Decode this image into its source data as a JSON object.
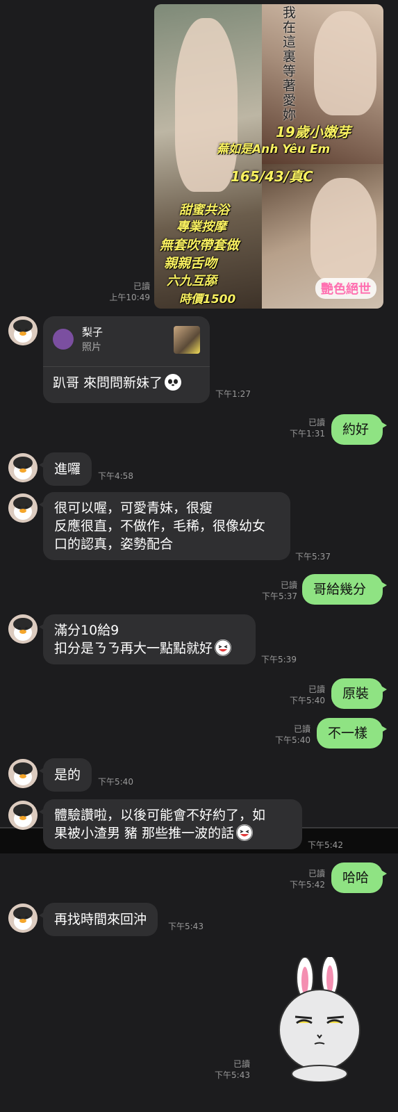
{
  "poster": {
    "vertical_text": "我在這裏等著愛妳",
    "age_label": "19歲小嫩芽",
    "name_line": "蕪如是Anh Yêu Em",
    "stats": "165/43/真C",
    "services": [
      "甜蜜共浴",
      "專業按摩",
      "無套吹帶套做",
      "親親舌吻",
      "六九互舔",
      "時價1500"
    ],
    "brand": "艷色絕世",
    "read": "已讀",
    "time": "上午10:49"
  },
  "quote_card": {
    "name": "梨子",
    "sub": "照片",
    "text": "趴哥  來問問新妹了",
    "time": "下午1:27"
  },
  "messages": [
    {
      "side": "out",
      "text": "約好",
      "read": "已讀",
      "time": "下午1:31"
    },
    {
      "side": "in",
      "text": "進囉",
      "time": "下午4:58"
    },
    {
      "side": "in",
      "lines": [
        "很可以喔，可愛青妹，很瘦",
        "反應很直，不做作，毛稀，很像幼女",
        "口的認真，姿勢配合"
      ],
      "time": "下午5:37"
    },
    {
      "side": "out",
      "text": "哥給幾分",
      "read": "已讀",
      "time": "下午5:37"
    },
    {
      "side": "in",
      "lines": [
        "滿分10給9",
        "扣分是ㄋㄋ再大一點點就好"
      ],
      "time": "下午5:39"
    },
    {
      "side": "out",
      "text": "原裝",
      "read": "已讀",
      "time": "下午5:40"
    },
    {
      "side": "out",
      "text": "不一樣",
      "read": "已讀",
      "time": "下午5:40"
    },
    {
      "side": "in",
      "text": "是的",
      "time": "下午5:40"
    },
    {
      "side": "in",
      "lines": [
        "體驗讚啦，以後可能會不好約了，如",
        "果被小渣男 豬 那些推一波的話"
      ],
      "time": "下午5:42"
    },
    {
      "side": "out",
      "text": "哈哈",
      "read": "已讀",
      "time": "下午5:42"
    },
    {
      "side": "in",
      "text": "再找時間來回沖",
      "time": "下午5:43"
    }
  ],
  "sticker": {
    "icon": "brown-bunny-sticker",
    "read": "已讀",
    "time": "下午5:43"
  },
  "colors": {
    "background": "#1c1c1e",
    "incoming": "#2f2f31",
    "outgoing": "#8fe383"
  }
}
